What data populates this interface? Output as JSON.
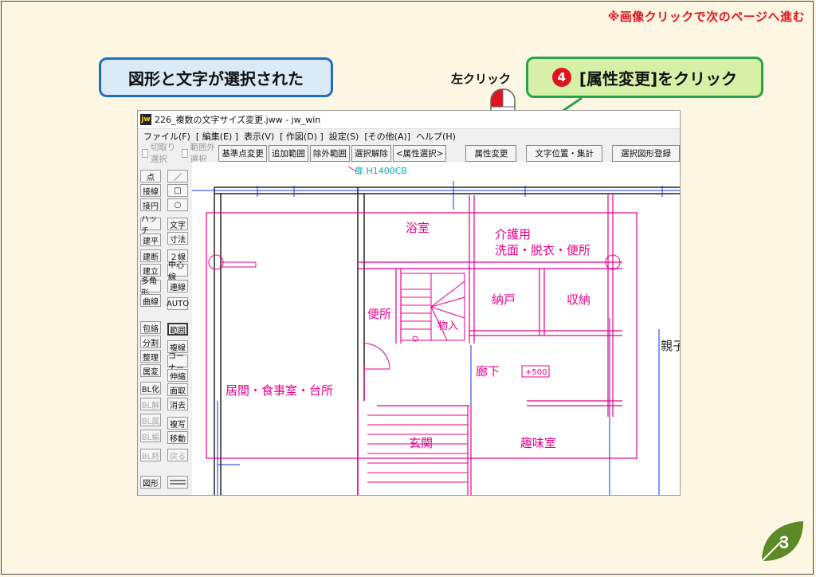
{
  "notice": "※画像クリックで次のページへ進む",
  "callout_selected": "図形と文字が選択された",
  "click_label": "左クリック",
  "step": {
    "number": "4",
    "text": "[属性変更]をクリック"
  },
  "window": {
    "title": "226_複数の文字サイズ変更.jww - jw_win",
    "icon": "jw",
    "menu": [
      "ファイル(F)",
      "[ 編集(E) ]",
      "表示(V)",
      "[ 作図(D) ]",
      "設定(S)",
      "[その他(A)]",
      "ヘルプ(H)"
    ],
    "checks": [
      "切取り選択",
      "範囲外選択"
    ],
    "tool_buttons": [
      "基準点変更",
      "追加範囲",
      "除外範囲",
      "選択解除",
      "<属性選択>"
    ],
    "right_buttons": [
      "属性変更",
      "文字位置・集計",
      "選択図形登録"
    ],
    "side_left": [
      "点",
      "接線",
      "接円",
      "ハッチ",
      "建平",
      "建断",
      "建立",
      "多角形",
      "曲線",
      "包絡",
      "分割",
      "整理",
      "属変",
      "BL化",
      "BL解",
      "BL属",
      "BL編",
      "BL終",
      "図形"
    ],
    "side_right": [
      "／",
      "□",
      "○",
      "文字",
      "寸法",
      "２線",
      "中心線",
      "連線",
      "AUTO",
      "範囲",
      "複線",
      "コーナー",
      "伸縮",
      "面取",
      "消去",
      "複写",
      "移動",
      "戻る"
    ]
  },
  "drawing": {
    "header_text": "扉 H1400CB",
    "rooms": [
      "浴室",
      "介護用",
      "洗面・脱衣・便所",
      "便所",
      "物入",
      "納戸",
      "収納",
      "廊下",
      "居間・食事室・台所",
      "玄関",
      "趣味室"
    ],
    "dim_tag": "+500",
    "edge_label": "親子"
  },
  "page_number": "3",
  "colors": {
    "accent_red": "#e0141e",
    "blue_border": "#1f6fbf",
    "green_border": "#27a34a",
    "selected": "#e8008c",
    "wall": "#222222",
    "grid": "#1133dd"
  }
}
